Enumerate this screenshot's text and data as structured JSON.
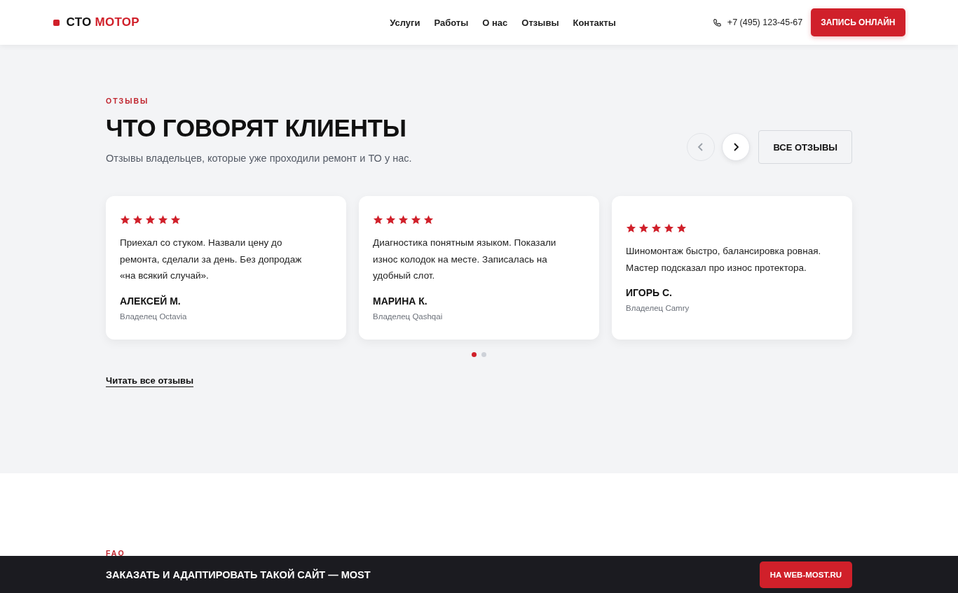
{
  "header": {
    "logo": {
      "first": "СТО",
      "second": "МОТОР"
    },
    "nav": [
      "Услуги",
      "Работы",
      "О нас",
      "Отзывы",
      "Контакты"
    ],
    "phone": "+7 (495) 123-45-67",
    "cta": "ЗАПИСЬ ОНЛАЙН"
  },
  "reviews_section": {
    "eyebrow": "ОТЗЫВЫ",
    "title": "ЧТО ГОВОРЯТ КЛИЕНТЫ",
    "subtitle": "Отзывы владельцев, которые уже проходили ремонт и ТО у нас.",
    "arrows": [
      {
        "kind": "prev",
        "disabled": true
      },
      {
        "kind": "next",
        "disabled": false
      }
    ],
    "all_button": "ВСЕ ОТЗЫВЫ",
    "reviews": [
      {
        "stars": 5,
        "text": "Приехал со стуком. Назвали цену до ремонта, сделали за день. Без допродаж «на всякий случай».",
        "author": "АЛЕКСЕЙ М.",
        "car": "Владелец Octavia"
      },
      {
        "stars": 5,
        "text": "Диагностика понятным языком. Показали износ колодок на месте. Записалась на удобный слот.",
        "author": "МАРИНА К.",
        "car": "Владелец Qashqai"
      },
      {
        "stars": 5,
        "text": "Шиномонтаж быстро, балансировка ровная. Мастер подсказал про износ протектора.",
        "author": "ИГОРЬ С.",
        "car": "Владелец Camry"
      }
    ],
    "dots": [
      {
        "selected": true
      },
      {
        "selected": false
      }
    ],
    "read_all_link": "Читать все отзывы"
  },
  "faq_section": {
    "eyebrow": "FAQ"
  },
  "bottom_bar": {
    "text": "ЗАКАЗАТЬ И АДАПТИРОВАТЬ ТАКОЙ САЙТ — MOST",
    "button": "НА WEB-MOST.RU"
  }
}
